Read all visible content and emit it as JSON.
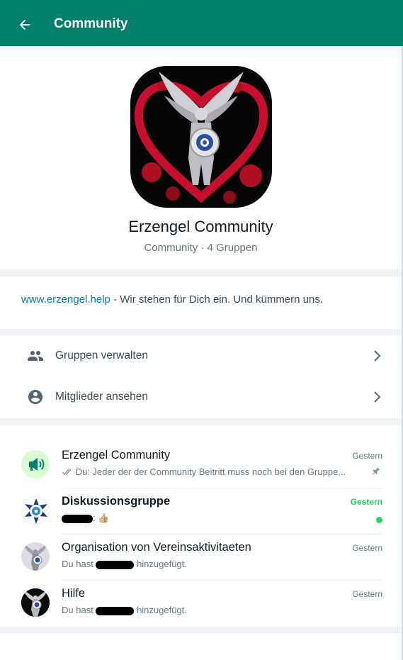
{
  "header": {
    "title": "Community",
    "back_icon": "arrow-left-icon"
  },
  "community": {
    "name": "Erzengel Community",
    "subtitle": "Community · 4 Gruppen"
  },
  "description": {
    "link": "www.erzengel.help",
    "text": " - Wir stehen für Dich ein. Und kümmern uns."
  },
  "actions": [
    {
      "label": "Gruppen verwalten",
      "icon": "groups-icon"
    },
    {
      "label": "Mitglieder ansehen",
      "icon": "account-icon"
    }
  ],
  "chats": [
    {
      "name": "Erzengel Community",
      "time": "Gestern",
      "message": "Du: Jeder der der Community Beitritt muss noch bei den Gruppe...",
      "icon": "megaphone-icon",
      "status": "pin-icon"
    },
    {
      "name": "Diskussionsgruppe",
      "time": "Gestern",
      "message_suffix": ": 👍🏼",
      "time_color": "#25d366",
      "status": "unread-dot"
    },
    {
      "name": "Organisation von Vereinsaktivitaeten",
      "time": "Gestern",
      "message_prefix": "Du hast",
      "message_suffix": "hinzugefügt."
    },
    {
      "name": "Hilfe",
      "time": "Gestern",
      "message_prefix": "Du hast",
      "message_suffix": "hinzugefügt."
    }
  ],
  "colors": {
    "header": "#008069",
    "accent_green": "#25d366",
    "link": "#027eb5",
    "community_icon_bg": "#d9fdd3"
  }
}
